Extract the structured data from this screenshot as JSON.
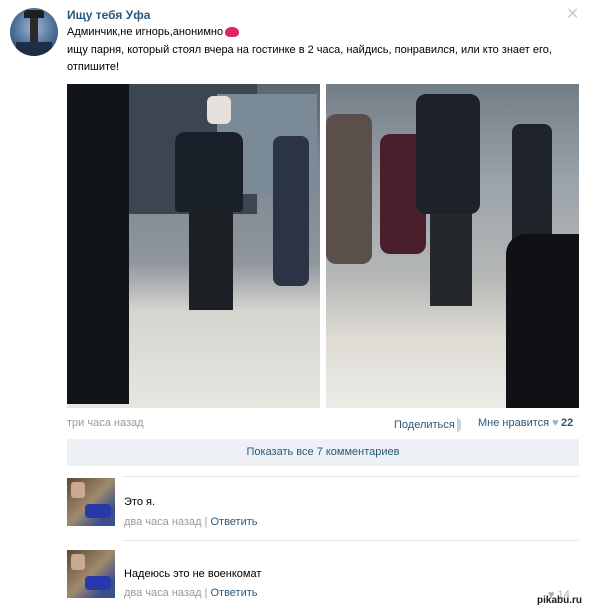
{
  "post": {
    "group_name": "Ищу тебя Уфа",
    "line1": "Админчик,не игнорь,анонимно",
    "line2": "ищу парня, который стоял вчера на гостинке в 2 часа, найдись, понравился, или кто знает его,",
    "line3": "отпишите!",
    "time": "три часа назад",
    "share_label": "Поделиться",
    "like_label": "Мне нравится",
    "like_count": "22",
    "show_comments": "Показать все 7 комментариев"
  },
  "comments": [
    {
      "text": "Это я.",
      "time": "два часа назад",
      "separator": "|",
      "reply": "Ответить"
    },
    {
      "text": "Надеюсь это не военкомат",
      "time": "два часа назад",
      "separator": "|",
      "reply": "Ответить",
      "likes": "14"
    }
  ],
  "watermark": "pikabu.ru",
  "icons": {
    "close": "close-icon",
    "share": "share-icon",
    "heart": "heart-icon",
    "kiss": "lips-emoji-icon"
  },
  "colors": {
    "link": "#2b587a",
    "muted": "#999999",
    "button_bg": "#edf1f5"
  }
}
